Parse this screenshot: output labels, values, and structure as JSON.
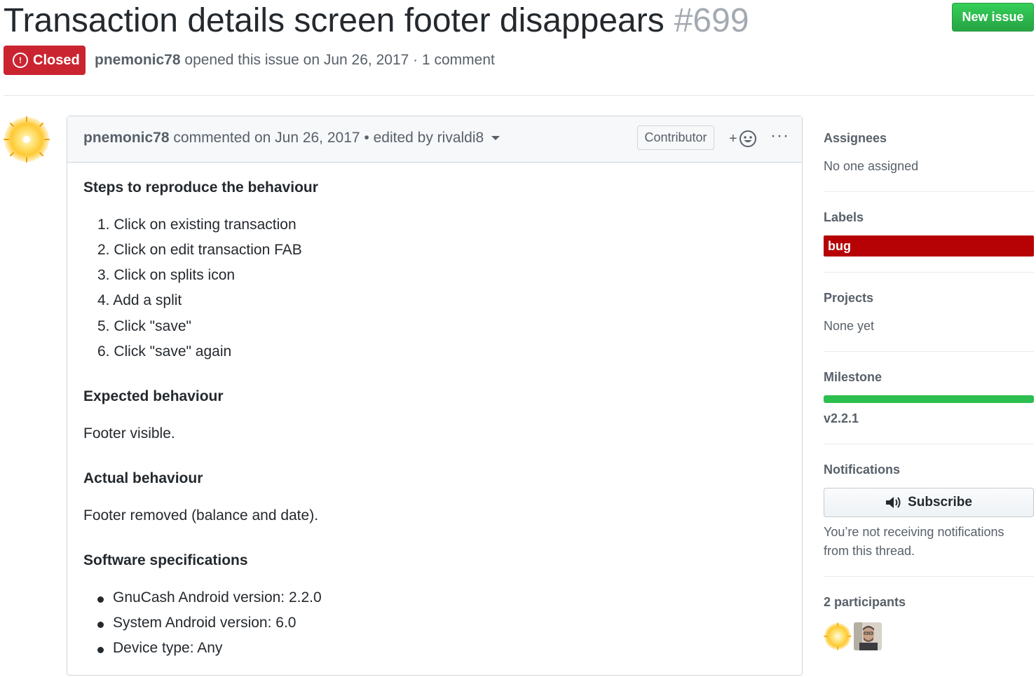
{
  "issue": {
    "title": "Transaction details screen footer disappears",
    "number": "#699",
    "new_issue_label": "New issue",
    "state": "Closed",
    "author": "pnemonic78",
    "opened_text": "opened this issue on Jun 26, 2017 · 1 comment"
  },
  "comment": {
    "author": "pnemonic78",
    "header_text": "commented on Jun 26, 2017 • edited by rivaldi8",
    "badge": "Contributor",
    "reaction_icon": "smiley-plus-icon",
    "more_icon": "kebab-horizontal-icon",
    "steps_heading": "Steps to reproduce the behaviour",
    "steps": [
      "1. Click on existing transaction",
      "2. Click on edit transaction FAB",
      "3. Click on splits icon",
      "4. Add a split",
      "5. Click \"save\"",
      "6. Click \"save\" again"
    ],
    "expected_heading": "Expected behaviour",
    "expected_text": "Footer visible.",
    "actual_heading": "Actual behaviour",
    "actual_text": "Footer removed (balance and date).",
    "specs_heading": "Software specifications",
    "specs": [
      "GnuCash Android version: 2.2.0",
      "System Android version: 6.0",
      "Device type: Any"
    ]
  },
  "sidebar": {
    "assignees_heading": "Assignees",
    "assignees_value": "No one assigned",
    "labels_heading": "Labels",
    "label_bug": "bug",
    "projects_heading": "Projects",
    "projects_value": "None yet",
    "milestone_heading": "Milestone",
    "milestone_progress": 1.0,
    "milestone_name": "v2.2.1",
    "notifications_heading": "Notifications",
    "subscribe_label": "Subscribe",
    "notifications_line1": "You’re not receiving notifications",
    "notifications_line2": "from this thread.",
    "participants_heading": "2 participants"
  },
  "colors": {
    "closed_red": "#cb2431",
    "new_issue_green": "#28a745",
    "label_bug": "#b60205",
    "milestone_green": "#2cbe4e"
  }
}
